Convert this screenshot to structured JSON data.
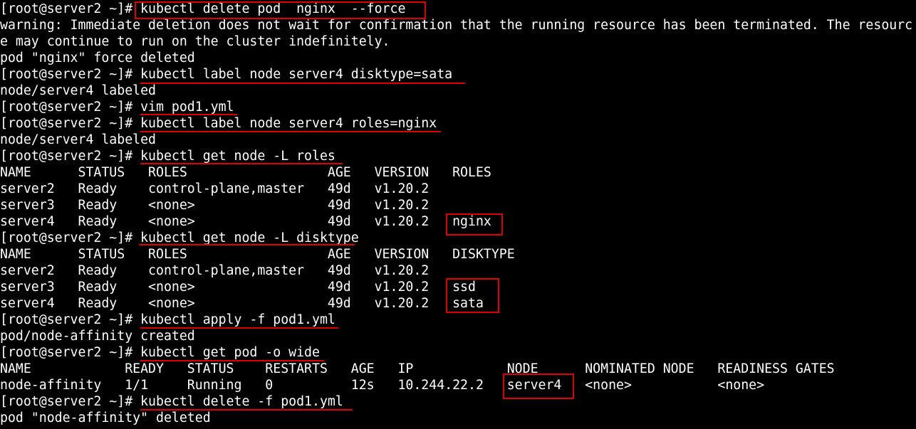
{
  "terminal": {
    "prompt": "[root@server2 ~]# ",
    "accent_color": "#e00000",
    "lines": [
      {
        "type": "command",
        "text": "kubectl delete pod  nginx  --force"
      },
      {
        "type": "output",
        "text": "warning: Immediate deletion does not wait for confirmation that the running resource has been terminated. The resourc"
      },
      {
        "type": "output",
        "text": "e may continue to run on the cluster indefinitely."
      },
      {
        "type": "output",
        "text": "pod \"nginx\" force deleted"
      },
      {
        "type": "command",
        "text": "kubectl label node server4 disktype=sata"
      },
      {
        "type": "output",
        "text": "node/server4 labeled"
      },
      {
        "type": "command",
        "text": "vim pod1.yml"
      },
      {
        "type": "command",
        "text": "kubectl label node server4 roles=nginx"
      },
      {
        "type": "output",
        "text": "node/server4 labeled"
      },
      {
        "type": "command",
        "text": "kubectl get node -L roles"
      },
      {
        "type": "output",
        "text": "NAME      STATUS   ROLES                  AGE   VERSION   ROLES"
      },
      {
        "type": "output",
        "text": "server2   Ready    control-plane,master   49d   v1.20.2"
      },
      {
        "type": "output",
        "text": "server3   Ready    <none>                 49d   v1.20.2"
      },
      {
        "type": "output",
        "text": "server4   Ready    <none>                 49d   v1.20.2   nginx"
      },
      {
        "type": "command",
        "text": "kubectl get node -L disktype"
      },
      {
        "type": "output",
        "text": "NAME      STATUS   ROLES                  AGE   VERSION   DISKTYPE"
      },
      {
        "type": "output",
        "text": "server2   Ready    control-plane,master   49d   v1.20.2"
      },
      {
        "type": "output",
        "text": "server3   Ready    <none>                 49d   v1.20.2   ssd"
      },
      {
        "type": "output",
        "text": "server4   Ready    <none>                 49d   v1.20.2   sata"
      },
      {
        "type": "command",
        "text": "kubectl apply -f pod1.yml"
      },
      {
        "type": "output",
        "text": "pod/node-affinity created"
      },
      {
        "type": "command",
        "text": "kubectl get pod -o wide"
      },
      {
        "type": "output",
        "text": "NAME            READY   STATUS    RESTARTS   AGE   IP            NODE      NOMINATED NODE   READINESS GATES"
      },
      {
        "type": "output",
        "text": "node-affinity   1/1     Running   0          12s   10.244.22.2   server4   <none>           <none>"
      },
      {
        "type": "command",
        "text": "kubectl delete -f pod1.yml"
      },
      {
        "type": "output",
        "text": "pod \"node-affinity\" deleted"
      }
    ]
  }
}
